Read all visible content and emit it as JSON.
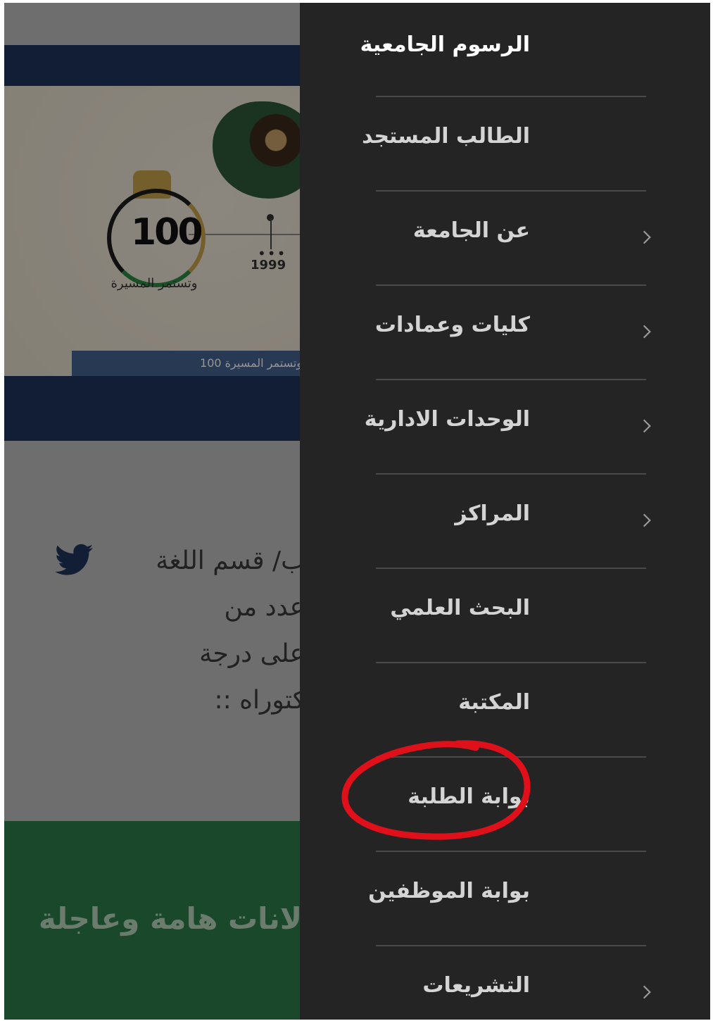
{
  "background": {
    "slide": {
      "caption": "وتستمر المسيرة 100",
      "emblem_number": "100",
      "emblem_text": "وتستمر المسيرة",
      "timeline_year": "1999"
    },
    "news": {
      "lines": [
        "ب/ قسم اللغة",
        "عدد من",
        "على درجة",
        "كتوراه ::"
      ]
    },
    "announcements_title": "لانات هامة وعاجلة"
  },
  "drawer": {
    "items": [
      {
        "label": "الرسوم الجامعية",
        "has_submenu": false
      },
      {
        "label": "الطالب المستجد",
        "has_submenu": false
      },
      {
        "label": "عن الجامعة",
        "has_submenu": true
      },
      {
        "label": "كليات وعمادات",
        "has_submenu": true
      },
      {
        "label": "الوحدات الادارية",
        "has_submenu": true
      },
      {
        "label": "المراكز",
        "has_submenu": true
      },
      {
        "label": "البحث العلمي",
        "has_submenu": false
      },
      {
        "label": "المكتبة",
        "has_submenu": false
      },
      {
        "label": "بوابة الطلبة",
        "has_submenu": false,
        "highlighted": true
      },
      {
        "label": "بوابة الموظفين",
        "has_submenu": false
      },
      {
        "label": "التشريعات",
        "has_submenu": true
      }
    ]
  },
  "colors": {
    "drawer_bg": "#242424",
    "navy": "#1e355c",
    "green": "#2e7d4a",
    "highlight_circle": "#e0101a"
  }
}
